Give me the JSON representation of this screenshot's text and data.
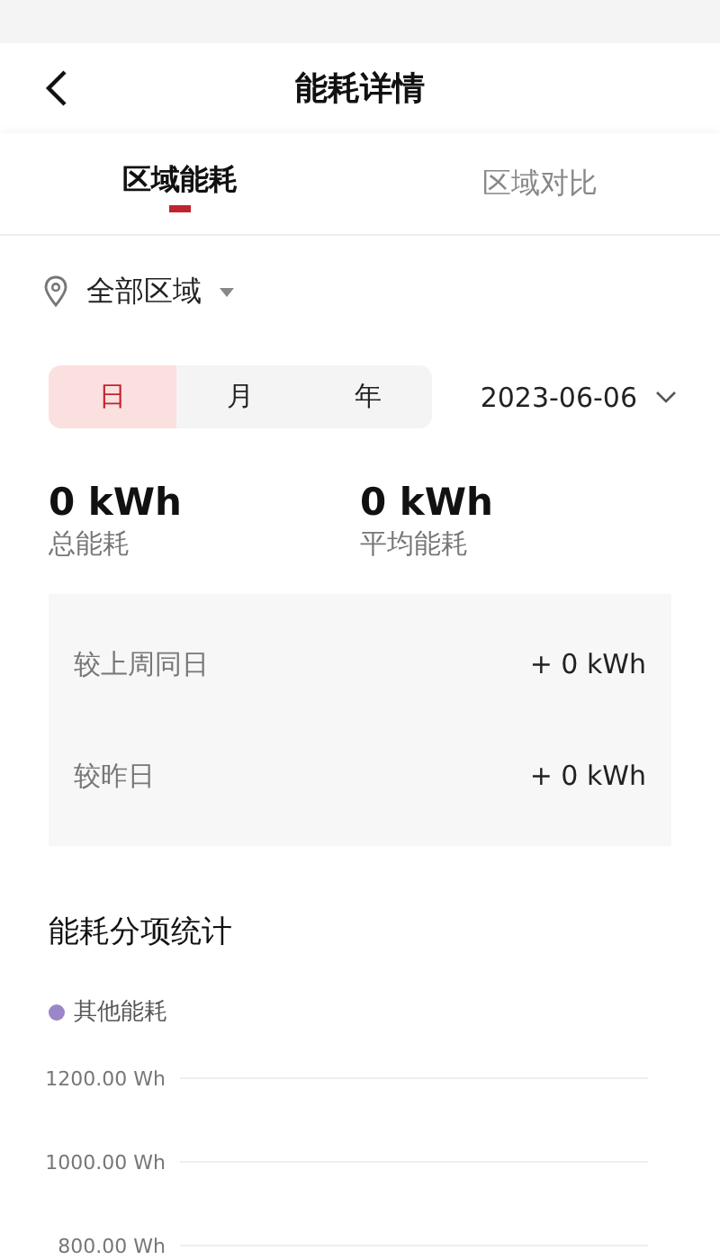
{
  "header": {
    "title": "能耗详情"
  },
  "tabs": [
    {
      "label": "区域能耗",
      "selected": true
    },
    {
      "label": "区域对比",
      "selected": false
    }
  ],
  "region_selector": {
    "value": "全部区域"
  },
  "period_options": [
    {
      "label": "日",
      "selected": true
    },
    {
      "label": "月",
      "selected": false
    },
    {
      "label": "年",
      "selected": false
    }
  ],
  "date_picker": {
    "value": "2023-06-06"
  },
  "stats": [
    {
      "value": "0 kWh",
      "label": "总能耗"
    },
    {
      "value": "0 kWh",
      "label": "平均能耗"
    }
  ],
  "comparisons": [
    {
      "label": "较上周同日",
      "value": "+ 0 kWh"
    },
    {
      "label": "较昨日",
      "value": "+ 0 kWh"
    }
  ],
  "breakdown": {
    "title": "能耗分项统计",
    "chart_data": {
      "type": "line",
      "ylim": [
        800,
        1200
      ],
      "grid": true,
      "series": [
        {
          "name": "其他能耗",
          "color": "#9b86c7"
        }
      ],
      "yticks": [
        {
          "value": 1200,
          "label": "1200.00 Wh"
        },
        {
          "value": 1000,
          "label": "1000.00 Wh"
        },
        {
          "value": 800,
          "label": "800.00 Wh"
        }
      ]
    }
  }
}
